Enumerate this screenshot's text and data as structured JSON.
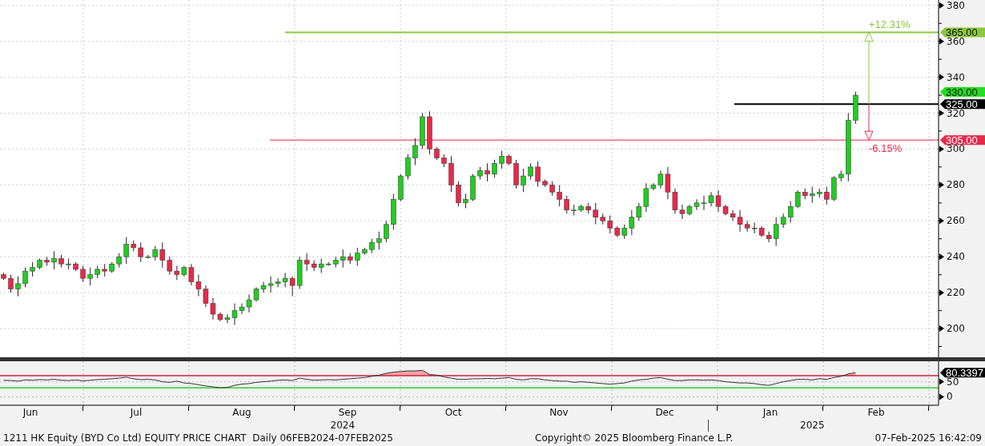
{
  "price_chart": {
    "chart_data": {
      "type": "candlestick",
      "ylim": [
        184,
        383
      ],
      "yticks": [
        200,
        220,
        240,
        260,
        280,
        300,
        320,
        340,
        360,
        380
      ],
      "grid": true,
      "ohlc": [
        [
          230,
          231,
          227,
          228
        ],
        [
          228,
          230,
          220,
          222
        ],
        [
          222,
          229,
          218,
          225
        ],
        [
          225,
          234,
          223,
          232
        ],
        [
          232,
          237,
          229,
          234
        ],
        [
          234,
          239,
          233,
          238
        ],
        [
          238,
          240,
          235,
          237
        ],
        [
          237,
          243,
          233,
          239
        ],
        [
          239,
          241,
          234,
          236
        ],
        [
          236,
          239,
          233,
          236
        ],
        [
          236,
          237,
          232,
          233
        ],
        [
          233,
          235,
          226,
          228
        ],
        [
          228,
          234,
          224,
          230
        ],
        [
          230,
          235,
          228,
          233
        ],
        [
          233,
          236,
          229,
          232
        ],
        [
          232,
          237,
          231,
          236
        ],
        [
          236,
          242,
          234,
          240
        ],
        [
          240,
          251,
          236,
          247
        ],
        [
          247,
          249,
          243,
          245
        ],
        [
          245,
          248,
          237,
          240
        ],
        [
          240,
          241,
          239,
          240
        ],
        [
          240,
          246,
          238,
          244
        ],
        [
          244,
          248,
          234,
          238
        ],
        [
          238,
          240,
          230,
          232
        ],
        [
          232,
          235,
          227,
          230
        ],
        [
          230,
          235,
          229,
          234
        ],
        [
          234,
          236,
          224,
          226
        ],
        [
          226,
          230,
          218,
          222
        ],
        [
          222,
          224,
          212,
          214
        ],
        [
          214,
          217,
          205,
          208
        ],
        [
          208,
          209,
          204,
          205
        ],
        [
          205,
          208,
          203,
          206
        ],
        [
          206,
          214,
          202,
          210
        ],
        [
          210,
          214,
          208,
          212
        ],
        [
          212,
          219,
          209,
          216
        ],
        [
          216,
          223,
          215,
          222
        ],
        [
          222,
          226,
          220,
          224
        ],
        [
          224,
          229,
          220,
          225
        ],
        [
          225,
          228,
          223,
          226
        ],
        [
          226,
          231,
          223,
          228
        ],
        [
          228,
          229,
          218,
          224
        ],
        [
          224,
          240,
          222,
          238
        ],
        [
          238,
          242,
          232,
          236
        ],
        [
          236,
          238,
          232,
          234
        ],
        [
          234,
          239,
          231,
          236
        ],
        [
          236,
          237,
          235,
          236
        ],
        [
          236,
          240,
          234,
          238
        ],
        [
          238,
          244,
          234,
          240
        ],
        [
          240,
          242,
          236,
          238
        ],
        [
          238,
          245,
          235,
          242
        ],
        [
          242,
          245,
          241,
          244
        ],
        [
          244,
          250,
          242,
          248
        ],
        [
          248,
          254,
          244,
          250
        ],
        [
          250,
          260,
          248,
          258
        ],
        [
          258,
          275,
          255,
          272
        ],
        [
          272,
          286,
          271,
          285
        ],
        [
          285,
          297,
          283,
          295
        ],
        [
          295,
          306,
          291,
          302
        ],
        [
          302,
          320,
          300,
          318
        ],
        [
          318,
          321,
          297,
          300
        ],
        [
          300,
          301,
          294,
          295
        ],
        [
          295,
          297,
          290,
          292
        ],
        [
          292,
          296,
          276,
          280
        ],
        [
          280,
          282,
          268,
          270
        ],
        [
          270,
          275,
          267,
          272
        ],
        [
          272,
          286,
          271,
          285
        ],
        [
          285,
          290,
          283,
          288
        ],
        [
          288,
          292,
          282,
          286
        ],
        [
          286,
          294,
          284,
          292
        ],
        [
          292,
          299,
          289,
          296
        ],
        [
          296,
          297,
          291,
          292
        ],
        [
          292,
          294,
          278,
          280
        ],
        [
          280,
          289,
          276,
          285
        ],
        [
          285,
          292,
          283,
          290
        ],
        [
          290,
          293,
          279,
          282
        ],
        [
          282,
          283,
          279,
          280
        ],
        [
          280,
          282,
          274,
          276
        ],
        [
          276,
          280,
          268,
          272
        ],
        [
          272,
          274,
          264,
          266
        ],
        [
          266,
          269,
          263,
          266
        ],
        [
          266,
          269,
          265,
          268
        ],
        [
          268,
          270,
          264,
          266
        ],
        [
          266,
          270,
          258,
          262
        ],
        [
          262,
          264,
          258,
          260
        ],
        [
          260,
          263,
          253,
          256
        ],
        [
          256,
          257,
          251,
          252
        ],
        [
          252,
          258,
          250,
          256
        ],
        [
          256,
          266,
          252,
          262
        ],
        [
          262,
          270,
          260,
          268
        ],
        [
          268,
          281,
          265,
          278
        ],
        [
          278,
          281,
          277,
          280
        ],
        [
          280,
          288,
          278,
          286
        ],
        [
          286,
          290,
          272,
          276
        ],
        [
          276,
          278,
          264,
          266
        ],
        [
          266,
          269,
          261,
          264
        ],
        [
          264,
          269,
          263,
          268
        ],
        [
          268,
          272,
          266,
          270
        ],
        [
          270,
          274,
          266,
          270
        ],
        [
          270,
          276,
          268,
          274
        ],
        [
          274,
          277,
          265,
          268
        ],
        [
          268,
          269,
          263,
          264
        ],
        [
          264,
          266,
          260,
          262
        ],
        [
          262,
          266,
          254,
          258
        ],
        [
          258,
          260,
          254,
          256
        ],
        [
          256,
          259,
          253,
          256
        ],
        [
          256,
          257,
          251,
          252
        ],
        [
          252,
          254,
          248,
          250
        ],
        [
          250,
          262,
          246,
          258
        ],
        [
          258,
          264,
          256,
          262
        ],
        [
          262,
          271,
          259,
          268
        ],
        [
          268,
          277,
          267,
          276
        ],
        [
          276,
          278,
          272,
          274
        ],
        [
          274,
          279,
          270,
          275
        ],
        [
          275,
          278,
          273,
          276
        ],
        [
          276,
          279,
          269,
          272
        ],
        [
          272,
          285,
          271,
          284
        ],
        [
          284,
          288,
          282,
          286
        ],
        [
          286,
          320,
          282,
          316
        ],
        [
          316,
          332,
          314,
          330
        ],
        null,
        null,
        null,
        null,
        null,
        null,
        null,
        null,
        null,
        null,
        null
      ],
      "ref_lines": [
        {
          "axis": "y",
          "value": 365,
          "label": "365.00",
          "color": "#8cc63f"
        },
        {
          "axis": "y",
          "value": 305,
          "label": "305.00",
          "color": "#e8294a"
        },
        {
          "axis": "y",
          "value": 325,
          "label": "325.00",
          "color": "#000000"
        }
      ],
      "annotations": [
        {
          "text": "+12.31%"
        },
        {
          "text": "-6.15%"
        },
        {
          "text": "330.00"
        }
      ]
    }
  },
  "indicator_panel": {
    "chart_data": {
      "type": "line",
      "ylim": [
        -28,
        118
      ],
      "yticks": [
        0,
        50
      ],
      "grid": true,
      "series": [
        {
          "color": "#333333",
          "values": [
            55,
            54,
            52,
            56,
            55,
            57,
            56,
            58,
            55,
            54,
            56,
            53,
            55,
            57,
            58,
            60,
            62,
            65,
            60,
            57,
            58,
            56,
            50,
            48,
            52,
            46,
            44,
            40,
            36,
            33,
            30,
            31,
            38,
            42,
            44,
            48,
            50,
            52,
            55,
            56,
            54,
            62,
            58,
            55,
            56,
            57,
            56,
            58,
            60,
            62,
            64,
            68,
            72,
            78,
            82,
            84,
            86,
            86,
            88,
            74,
            72,
            66,
            62,
            58,
            58,
            60,
            60,
            61,
            60,
            62,
            64,
            58,
            56,
            60,
            60,
            56,
            54,
            52,
            52,
            48,
            50,
            48,
            46,
            44,
            42,
            44,
            46,
            52,
            56,
            58,
            62,
            64,
            58,
            54,
            54,
            56,
            56,
            55,
            56,
            54,
            50,
            48,
            46,
            46,
            44,
            40,
            38,
            44,
            50,
            54,
            58,
            58,
            56,
            60,
            58,
            64,
            68,
            76,
            80.3,
            null,
            null,
            null,
            null,
            null,
            null,
            null,
            null,
            null,
            null,
            null
          ]
        }
      ],
      "ref_lines": [
        {
          "axis": "y",
          "value": 70,
          "color": "#cc2233"
        },
        {
          "axis": "y",
          "value": 30,
          "color": "#33cc33"
        }
      ],
      "annotations": [
        {
          "text": "80.3397"
        }
      ]
    }
  },
  "time_axis": {
    "years": [
      {
        "label": "2024",
        "months": [
          {
            "label": "Jun"
          },
          {
            "label": "Jul"
          },
          {
            "label": "Aug"
          },
          {
            "label": "Sep"
          },
          {
            "label": "Oct"
          },
          {
            "label": "Nov"
          },
          {
            "label": "Dec"
          }
        ]
      },
      {
        "label": "2025",
        "months": [
          {
            "label": "Jan"
          },
          {
            "label": "Feb"
          }
        ]
      }
    ]
  },
  "footer": {
    "title": "1211 HK Equity (BYD Co Ltd) EQUITY PRICE CHART  Daily 06FEB2024-07FEB2025",
    "copyright": "Copyright© 2025 Bloomberg Finance L.P.",
    "timestamp": "07-Feb-2025 16:42:09"
  }
}
